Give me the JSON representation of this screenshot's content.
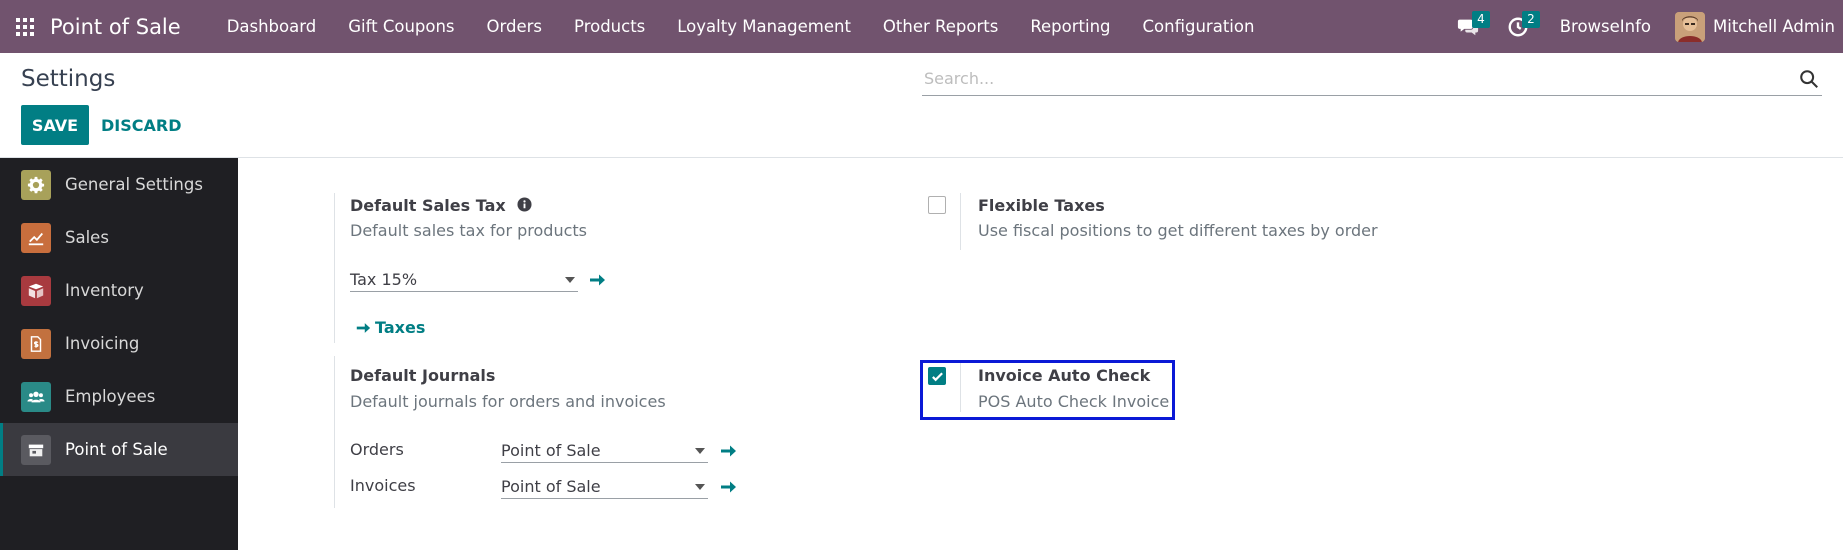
{
  "navbar": {
    "app_title": "Point of Sale",
    "menu": [
      {
        "label": "Dashboard"
      },
      {
        "label": "Gift Coupons"
      },
      {
        "label": "Orders"
      },
      {
        "label": "Products"
      },
      {
        "label": "Loyalty Management"
      },
      {
        "label": "Other Reports"
      },
      {
        "label": "Reporting"
      },
      {
        "label": "Configuration"
      }
    ],
    "messages_badge": "4",
    "activities_badge": "2",
    "company": "BrowseInfo",
    "user_name": "Mitchell Admin",
    "bar_color": "#71536e"
  },
  "control_panel": {
    "title": "Settings",
    "search_placeholder": "Search...",
    "save_label": "SAVE",
    "discard_label": "DISCARD"
  },
  "sidebar": {
    "items": [
      {
        "label": "General Settings",
        "icon": "gear-icon",
        "color": "#a8a15a"
      },
      {
        "label": "Sales",
        "icon": "chart-icon",
        "color": "#c86e3d"
      },
      {
        "label": "Inventory",
        "icon": "box-icon",
        "color": "#a83a3f"
      },
      {
        "label": "Invoicing",
        "icon": "invoice-icon",
        "color": "#c2713f"
      },
      {
        "label": "Employees",
        "icon": "people-icon",
        "color": "#2a8a87"
      },
      {
        "label": "Point of Sale",
        "icon": "store-icon",
        "color": "#5a5a60"
      }
    ],
    "active_index": 5
  },
  "settings": {
    "default_sales_tax": {
      "title": "Default Sales Tax",
      "description": "Default sales tax for products",
      "value": "Tax 15%",
      "link_label": "Taxes"
    },
    "flexible_taxes": {
      "title": "Flexible Taxes",
      "description": "Use fiscal positions to get different taxes by order",
      "checked": false
    },
    "default_journals": {
      "title": "Default Journals",
      "description": "Default journals for orders and invoices",
      "orders_label": "Orders",
      "orders_value": "Point of Sale",
      "invoices_label": "Invoices",
      "invoices_value": "Point of Sale"
    },
    "invoice_auto_check": {
      "title": "Invoice Auto Check",
      "description": "POS Auto Check Invoice",
      "checked": true
    }
  },
  "accent_color": "#017e84",
  "highlight_color": "#0b19d6"
}
